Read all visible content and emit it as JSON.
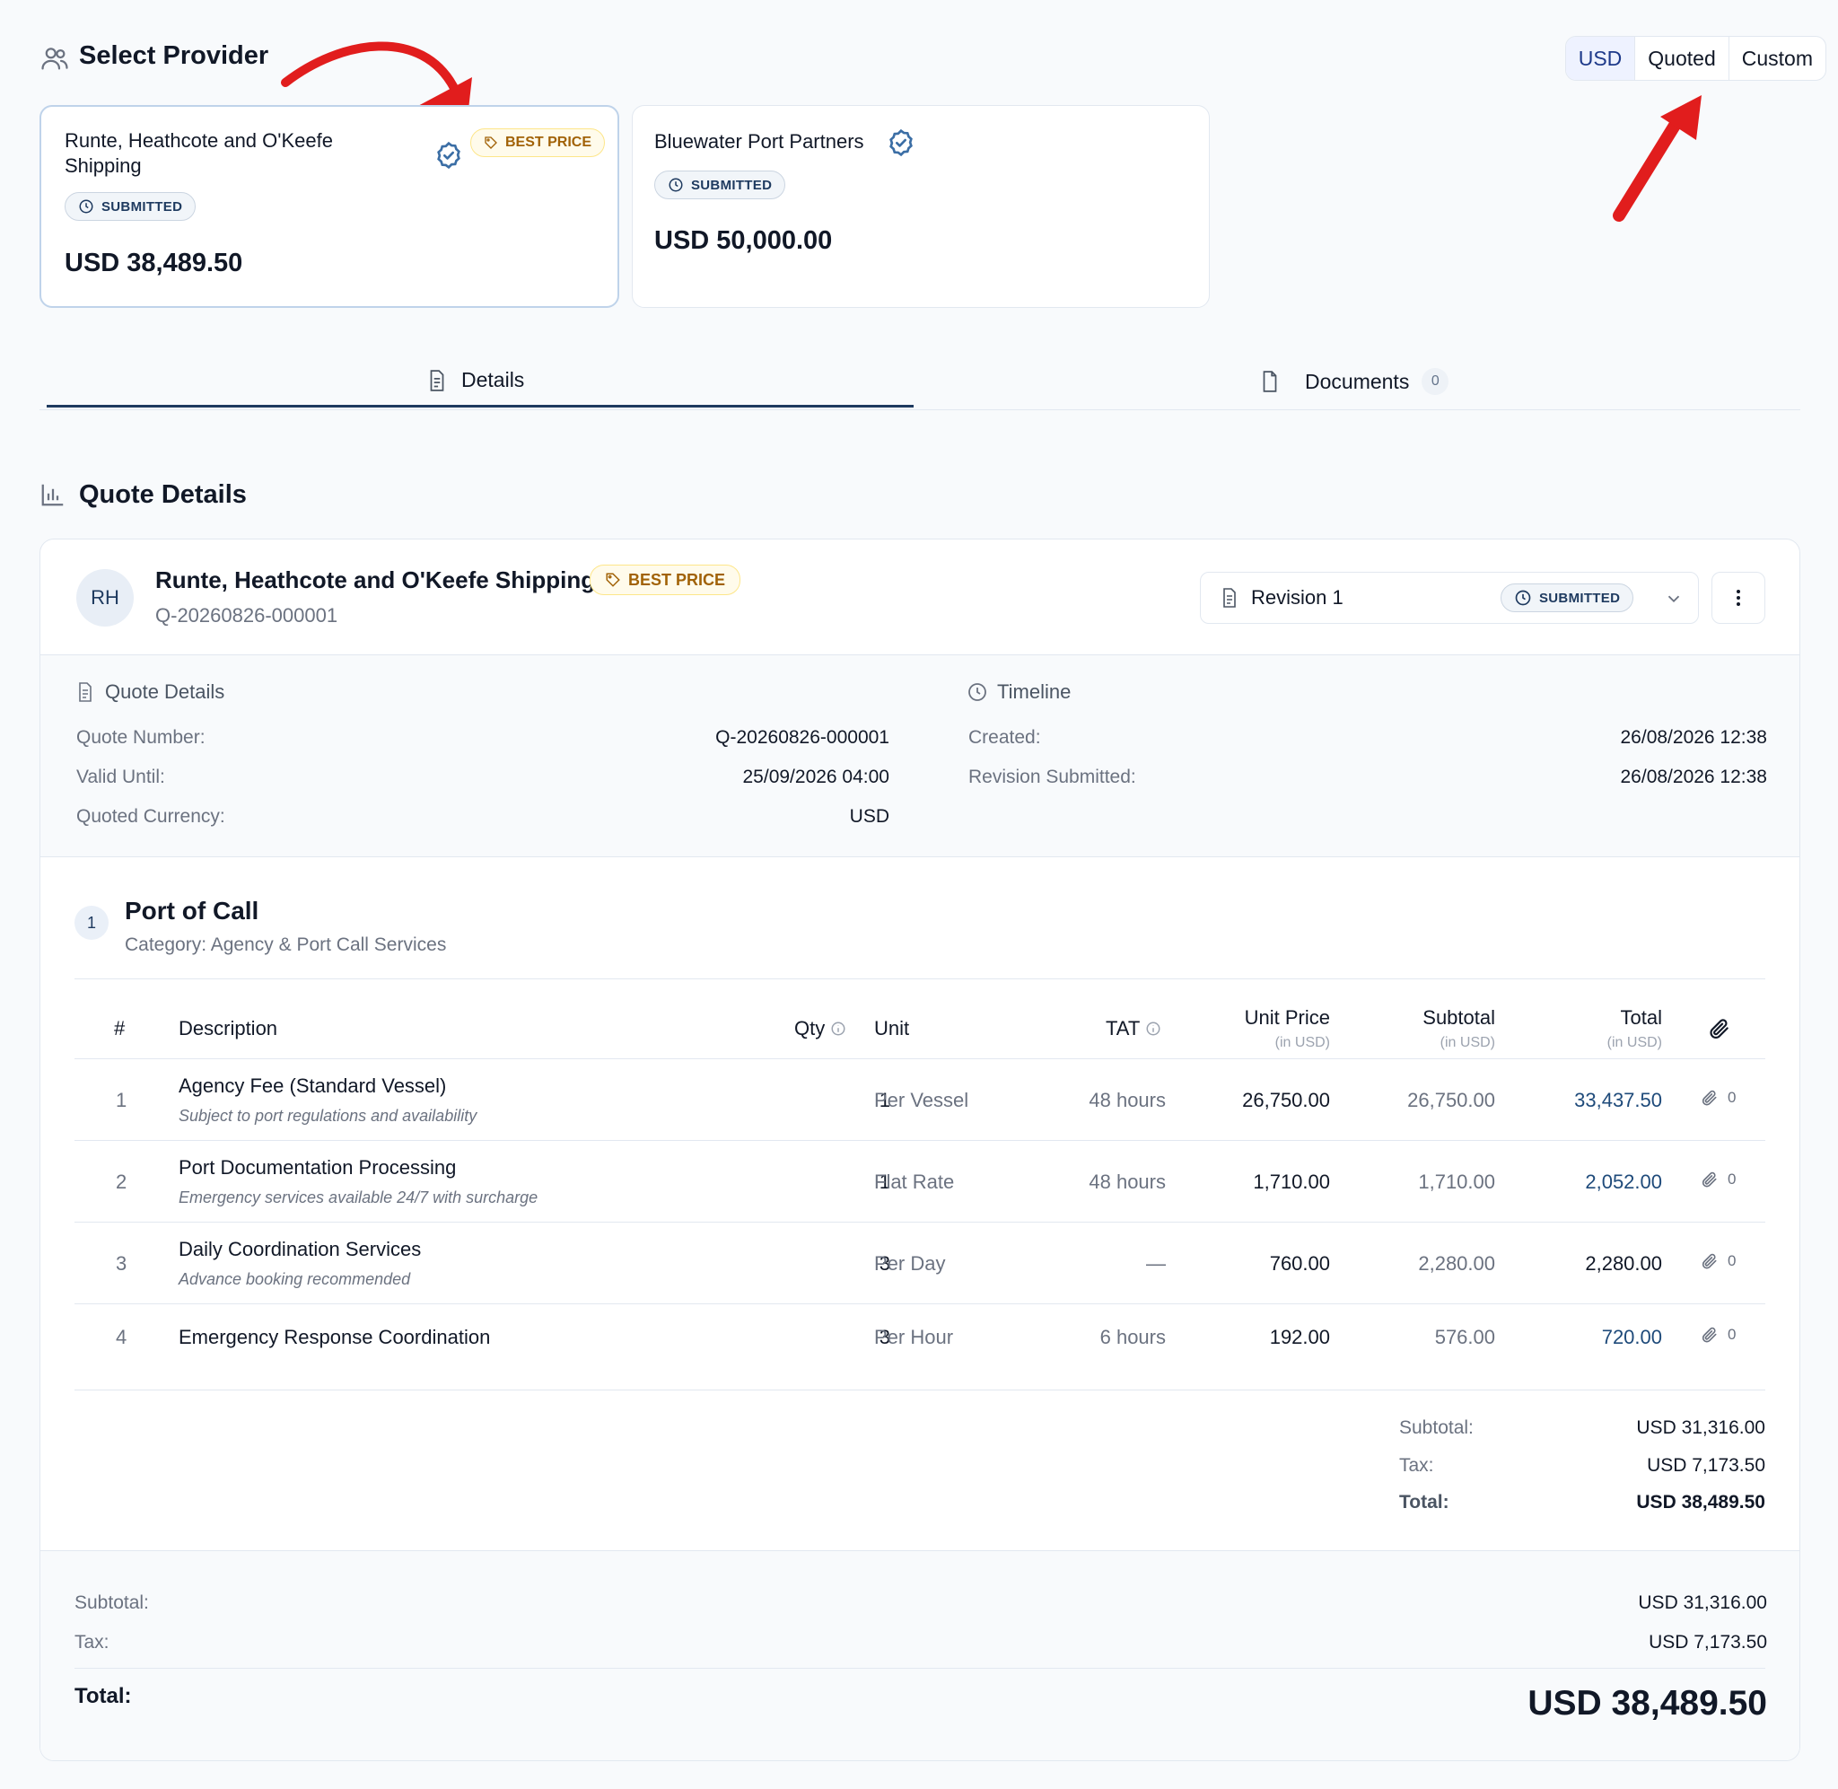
{
  "header": {
    "title": "Select Provider"
  },
  "currency_toggle": {
    "options": [
      "USD",
      "Quoted",
      "Custom"
    ],
    "selected": "USD"
  },
  "providers": [
    {
      "name_line1": "Runte, Heathcote and O'Keefe",
      "name_line2": "Shipping",
      "status": "SUBMITTED",
      "best_price": "BEST PRICE",
      "price": "USD 38,489.50"
    },
    {
      "name": "Bluewater Port Partners",
      "status": "SUBMITTED",
      "price": "USD 50,000.00"
    }
  ],
  "tabs": {
    "details": "Details",
    "documents": "Documents",
    "documents_count": "0"
  },
  "quote_details_heading": "Quote Details",
  "quote": {
    "avatar": "RH",
    "provider": "Runte, Heathcote and O'Keefe Shipping",
    "best_price": "BEST PRICE",
    "id": "Q-20260826-000001",
    "revision": "Revision 1",
    "revision_status": "SUBMITTED"
  },
  "info": {
    "left_heading": "Quote Details",
    "right_heading": "Timeline",
    "quote_number_label": "Quote Number:",
    "quote_number": "Q-20260826-000001",
    "valid_until_label": "Valid Until:",
    "valid_until": "25/09/2026 04:00",
    "quoted_currency_label": "Quoted Currency:",
    "quoted_currency": "USD",
    "created_label": "Created:",
    "created": "26/08/2026 12:38",
    "revision_submitted_label": "Revision Submitted:",
    "revision_submitted": "26/08/2026 12:38"
  },
  "section": {
    "num": "1",
    "title": "Port of Call",
    "category": "Category: Agency & Port Call Services"
  },
  "table": {
    "headers": {
      "num": "#",
      "description": "Description",
      "qty": "Qty",
      "unit": "Unit",
      "tat": "TAT",
      "unit_price": "Unit Price",
      "subtotal": "Subtotal",
      "total": "Total",
      "in_usd": "(in USD)"
    },
    "rows": [
      {
        "num": "1",
        "description": "Agency Fee (Standard Vessel)",
        "note": "Subject to port regulations and availability",
        "qty": "1",
        "unit": "Per Vessel",
        "tat": "48 hours",
        "unit_price": "26,750.00",
        "subtotal": "26,750.00",
        "total": "33,437.50",
        "attachments": "0"
      },
      {
        "num": "2",
        "description": "Port Documentation Processing",
        "note": "Emergency services available 24/7 with surcharge",
        "qty": "1",
        "unit": "Flat Rate",
        "tat": "48 hours",
        "unit_price": "1,710.00",
        "subtotal": "1,710.00",
        "total": "2,052.00",
        "attachments": "0"
      },
      {
        "num": "3",
        "description": "Daily Coordination Services",
        "note": "Advance booking recommended",
        "qty": "3",
        "unit": "Per Day",
        "tat": "—",
        "unit_price": "760.00",
        "subtotal": "2,280.00",
        "total": "2,280.00",
        "attachments": "0"
      },
      {
        "num": "4",
        "description": "Emergency Response Coordination",
        "note": "",
        "qty": "3",
        "unit": "Per Hour",
        "tat": "6 hours",
        "unit_price": "192.00",
        "subtotal": "576.00",
        "total": "720.00",
        "attachments": "0"
      }
    ]
  },
  "section_summary": {
    "subtotal_label": "Subtotal:",
    "subtotal": "USD 31,316.00",
    "tax_label": "Tax:",
    "tax": "USD 7,173.50",
    "total_label": "Total:",
    "total": "USD 38,489.50"
  },
  "grand_summary": {
    "subtotal_label": "Subtotal:",
    "subtotal": "USD 31,316.00",
    "tax_label": "Tax:",
    "tax": "USD 7,173.50",
    "total_label": "Total:",
    "total": "USD 38,489.50"
  },
  "colors": {
    "accent": "#1e3a5f",
    "best_price": "#a16207",
    "link": "#1e4a7a",
    "annotation_arrow": "#e11d1d"
  },
  "icons": [
    "users-icon",
    "verified-check-icon",
    "tag-icon",
    "clock-icon",
    "document-icon",
    "file-icon",
    "bar-chart-icon",
    "chevron-down-icon",
    "more-vertical-icon",
    "info-icon",
    "paperclip-icon"
  ]
}
